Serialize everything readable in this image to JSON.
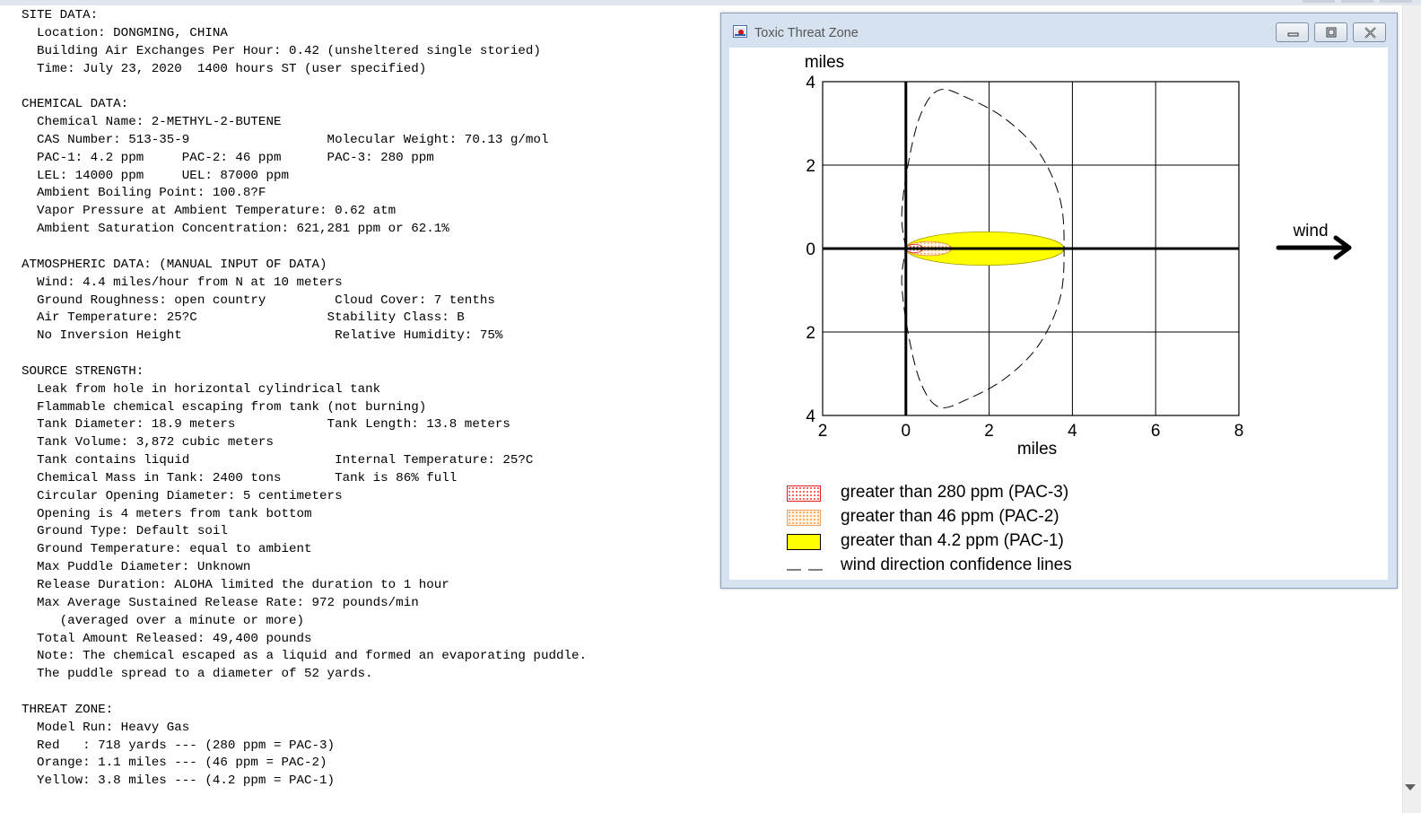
{
  "report": {
    "lines": [
      "SITE DATA:",
      "  Location: DONGMING, CHINA",
      "  Building Air Exchanges Per Hour: 0.42 (unsheltered single storied)",
      "  Time: July 23, 2020  1400 hours ST (user specified)",
      "",
      "CHEMICAL DATA:",
      "  Chemical Name: 2-METHYL-2-BUTENE",
      "  CAS Number: 513-35-9                  Molecular Weight: 70.13 g/mol",
      "  PAC-1: 4.2 ppm     PAC-2: 46 ppm      PAC-3: 280 ppm",
      "  LEL: 14000 ppm     UEL: 87000 ppm",
      "  Ambient Boiling Point: 100.8?F",
      "  Vapor Pressure at Ambient Temperature: 0.62 atm",
      "  Ambient Saturation Concentration: 621,281 ppm or 62.1%",
      "",
      "ATMOSPHERIC DATA: (MANUAL INPUT OF DATA)",
      "  Wind: 4.4 miles/hour from N at 10 meters",
      "  Ground Roughness: open country         Cloud Cover: 7 tenths",
      "  Air Temperature: 25?C                 Stability Class: B",
      "  No Inversion Height                    Relative Humidity: 75%",
      "",
      "SOURCE STRENGTH:",
      "  Leak from hole in horizontal cylindrical tank",
      "  Flammable chemical escaping from tank (not burning)",
      "  Tank Diameter: 18.9 meters            Tank Length: 13.8 meters",
      "  Tank Volume: 3,872 cubic meters",
      "  Tank contains liquid                   Internal Temperature: 25?C",
      "  Chemical Mass in Tank: 2400 tons       Tank is 86% full",
      "  Circular Opening Diameter: 5 centimeters",
      "  Opening is 4 meters from tank bottom",
      "  Ground Type: Default soil",
      "  Ground Temperature: equal to ambient",
      "  Max Puddle Diameter: Unknown",
      "  Release Duration: ALOHA limited the duration to 1 hour",
      "  Max Average Sustained Release Rate: 972 pounds/min",
      "     (averaged over a minute or more)",
      "  Total Amount Released: 49,400 pounds",
      "  Note: The chemical escaped as a liquid and formed an evaporating puddle.",
      "  The puddle spread to a diameter of 52 yards.",
      "",
      "THREAT ZONE:",
      "  Model Run: Heavy Gas",
      "  Red   : 718 yards --- (280 ppm = PAC-3)",
      "  Orange: 1.1 miles --- (46 ppm = PAC-2)",
      "  Yellow: 3.8 miles --- (4.2 ppm = PAC-1)"
    ]
  },
  "window": {
    "title": "Toxic Threat Zone",
    "buttons": {
      "minimize": "minimize-icon",
      "restore": "restore-icon",
      "close": "close-icon"
    }
  },
  "chart_data": {
    "type": "area",
    "y_unit_label": "miles",
    "x_unit_label": "miles",
    "wind_label": "wind",
    "x_ticks": [
      "2",
      "0",
      "2",
      "4",
      "6",
      "8"
    ],
    "y_ticks": [
      "4",
      "2",
      "0",
      "2",
      "4"
    ],
    "x_tick_values": [
      -2,
      0,
      2,
      4,
      6,
      8
    ],
    "y_tick_values": [
      4,
      2,
      0,
      -2,
      -4
    ],
    "xlim": [
      -2,
      8
    ],
    "ylim": [
      -4,
      4
    ],
    "grid": true,
    "zones": [
      {
        "name": "greater than 4.2 ppm (PAC-1)",
        "max_downwind_miles": 3.8,
        "half_width_miles": 0.4,
        "color": "#ffff00"
      },
      {
        "name": "greater than 46 ppm (PAC-2)",
        "max_downwind_miles": 1.1,
        "half_width_miles": 0.17,
        "color": "#ffb366"
      },
      {
        "name": "greater than 280 ppm (PAC-3)",
        "max_downwind_miles": 0.41,
        "half_width_miles": 0.1,
        "color": "#ff3030"
      }
    ],
    "confidence_lines": {
      "name": "wind direction confidence lines",
      "points": [
        [
          0,
          0
        ],
        [
          -0.1,
          0.8
        ],
        [
          0.05,
          2
        ],
        [
          0.35,
          3.2
        ],
        [
          0.8,
          3.8
        ],
        [
          1.5,
          3.6
        ],
        [
          2.4,
          3.1
        ],
        [
          3.2,
          2.3
        ],
        [
          3.7,
          1.2
        ],
        [
          3.8,
          0
        ],
        [
          3.7,
          -1.2
        ],
        [
          3.2,
          -2.3
        ],
        [
          2.4,
          -3.1
        ],
        [
          1.5,
          -3.6
        ],
        [
          0.8,
          -3.8
        ],
        [
          0.35,
          -3.2
        ],
        [
          0.05,
          -2
        ],
        [
          -0.1,
          -0.8
        ],
        [
          0,
          0
        ]
      ]
    },
    "legend": [
      {
        "label": "greater than 280 ppm (PAC-3)",
        "style": "dotted",
        "color": "#ff3030"
      },
      {
        "label": "greater than 46 ppm (PAC-2)",
        "style": "dotted",
        "color": "#ffa050"
      },
      {
        "label": "greater than 4.2 ppm (PAC-1)",
        "style": "solid",
        "color": "#ffff00"
      },
      {
        "label": "wind direction confidence lines",
        "style": "dashed",
        "color": "#000000"
      }
    ]
  }
}
